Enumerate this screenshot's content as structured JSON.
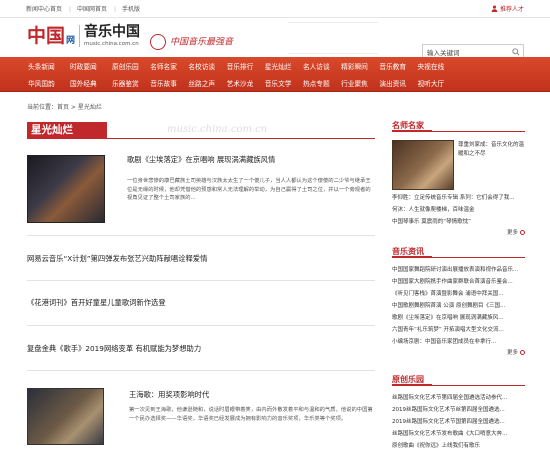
{
  "topbar": {
    "links": [
      "新闻中心首页",
      "中国网首页",
      "手机版"
    ],
    "right_label": "推荐人才"
  },
  "header": {
    "logo_mark": "中国",
    "logo_net": "网",
    "brand_cn": "音乐中国",
    "brand_en": "music.china.com.cn",
    "slogan": "中国音乐最强音"
  },
  "search": {
    "value": "输入关键词"
  },
  "nav": {
    "row1": [
      "头条新闻",
      "时政要闻",
      "原创乐园",
      "名师名家",
      "名校访谈",
      "音乐排行",
      "星光灿烂",
      "名人访谈",
      "精彩瞬间",
      "音乐教育",
      "央视在线"
    ],
    "row2": [
      "华风国韵",
      "国外经典",
      "乐器鉴赏",
      "音乐故事",
      "丝路之声",
      "艺术沙龙",
      "音乐文学",
      "热点专题",
      "行业聚焦",
      "演出资讯",
      "视听大厅"
    ]
  },
  "breadcrumb": "当前位置：首页 > 星光灿烂",
  "section_title": "星光灿烂",
  "watermark": "music.china.com.cn",
  "feature": {
    "title": "歌剧《尘埃落定》在京唱响 展现涡满藏族风情",
    "desc": "一位身世悲惨的康巴藏族土司英雄与汉族太太生了一个傻儿子，当人人都认为这个傻傻的二少爷与继承王位是无缘的时候，他却凭借他的预感和常人无法理解的举动，为自己赢得了土司之位，并以一个旁观者的视角见证了整个土司家族的..."
  },
  "news": [
    "网易云音乐“X计划”第四弹发布张艺兴助阵献唱诠释爱情",
    "《花港词刊》首开好童星儿童歌词新作选登",
    "复盘金典《歌手》2019网络变革 有机赋能为梦想助力"
  ],
  "feature2": {
    "title": "王海歌：用奖项影响时代",
    "desc": "第一次见到王海歌，他谦逊随和，说话时眉眼带着笑，由内而外散发着平和与温和的气质。他说的中国第一个民办选择奖——华语奖，华语奖已经发展成为拥有影响力的音乐奖项，华乐类等个奖项。"
  },
  "sidebar": {
    "famous": {
      "heading": "名师名家",
      "feature_title": "尊重刘家成：音乐文化的温暖和之不尽",
      "items": [
        "李仰胜：立足传统音乐专辑 系列：它们会得了我...",
        "何沐：人生就像爬楼梯，百味温金",
        "中国琴事乐 莫震雨的“琴情歌忱”"
      ],
      "more": "更多"
    },
    "info": {
      "heading": "音乐资讯",
      "items": [
        "中国国家舞蹈院研讨演出展播放表演和视作品音乐...",
        "中国国家大剧院携手作曲家群联合首演音乐鉴会...",
        "《听见门客栈》首演暨影舞会 浦语中拜关国...",
        "中国歌剧舞剧院首演 公演 原创舞剧目《三国...",
        "歌剧《尘埃落定》在京唱响 展现涡满藏族风...",
        "六国青年“礼乐筑梦” 开拓演唱大型文化交流...",
        "小编场京剧：中国音乐家团成员在非拿行..."
      ],
      "more": "更多"
    },
    "original": {
      "heading": "原创乐园",
      "items": [
        "丝路国际文化艺术节第四届全国遴选活动参代...",
        "2019丝路国际文化艺术节丝第四届全国遴选...",
        "2019丝路国际文化艺术节国第四届全国遴选...",
        "丝路国际文化艺术节发布歌曲《大口哨意大奔...",
        "原创歌曲《祝你远》上线我们有歌乐"
      ]
    }
  },
  "colors": {
    "accent": "#c0282c",
    "nav_bg": "#d03a22"
  }
}
